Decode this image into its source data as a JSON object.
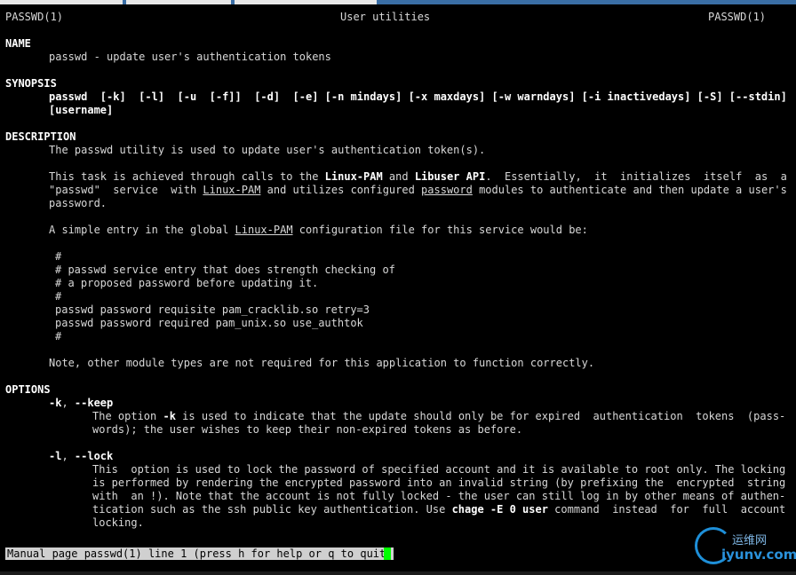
{
  "header": {
    "left": "PASSWD(1)",
    "center": "User utilities",
    "right": "PASSWD(1)"
  },
  "name": {
    "heading": "NAME",
    "text": "passwd - update user's authentication tokens"
  },
  "synopsis": {
    "heading": "SYNOPSIS",
    "line1": "passwd  [-k]  [-l]  [-u  [-f]]  [-d]  [-e] [-n mindays] [-x maxdays] [-w warndays] [-i inactivedays] [-S] [--stdin]",
    "line2": "[username]"
  },
  "description": {
    "heading": "DESCRIPTION",
    "p1": "The passwd utility is used to update user's authentication token(s).",
    "p2_l1_a": "This task is achieved through calls to the ",
    "p2_l1_b": "Linux-PAM",
    "p2_l1_c": " and ",
    "p2_l1_d": "Libuser API",
    "p2_l1_e": ".  Essentially,  it  initializes  itself  as  a",
    "p2_l2_a": "\"passwd\"  service  with ",
    "p2_l2_b": "Linux-PAM",
    "p2_l2_c": " and utilizes configured ",
    "p2_l2_d": "password",
    "p2_l2_e": " modules to authenticate and then update a user's",
    "p2_l3": "password.",
    "p3_a": "A simple entry in the global ",
    "p3_b": "Linux-PAM",
    "p3_c": " configuration file for this service would be:",
    "code": [
      "#",
      "# passwd service entry that does strength checking of",
      "# a proposed password before updating it.",
      "#",
      "passwd password requisite pam_cracklib.so retry=3",
      "passwd password required pam_unix.so use_authtok",
      "#"
    ],
    "p4": "Note, other module types are not required for this application to function correctly."
  },
  "options": {
    "heading": "OPTIONS",
    "k_flag_a": "-k",
    "k_flag_b": ", ",
    "k_flag_c": "--keep",
    "k_l1_a": "The option ",
    "k_l1_b": "-k",
    "k_l1_c": " is used to indicate that the update should only be for expired  authentication  tokens  (pass-",
    "k_l2": "words); the user wishes to keep their non-expired tokens as before.",
    "l_flag_a": "-l",
    "l_flag_b": ", ",
    "l_flag_c": "--lock",
    "l_l1": "This  option is used to lock the password of specified account and it is available to root only. The locking",
    "l_l2": "is performed by rendering the encrypted password into an invalid string (by prefixing the  encrypted  string",
    "l_l3": "with  an !). Note that the account is not fully locked - the user can still log in by other means of authen-",
    "l_l4_a": "tication such as the ssh public key authentication. Use ",
    "l_l4_b": "chage -E 0 user",
    "l_l4_c": " command  instead  for  full  account",
    "l_l5": "locking."
  },
  "status": "Manual page passwd(1) line 1 (press h for help or q to quit)",
  "watermark": {
    "cn": "运维网",
    "en": "iyunv.com",
    "color": "#1e8fd8"
  }
}
